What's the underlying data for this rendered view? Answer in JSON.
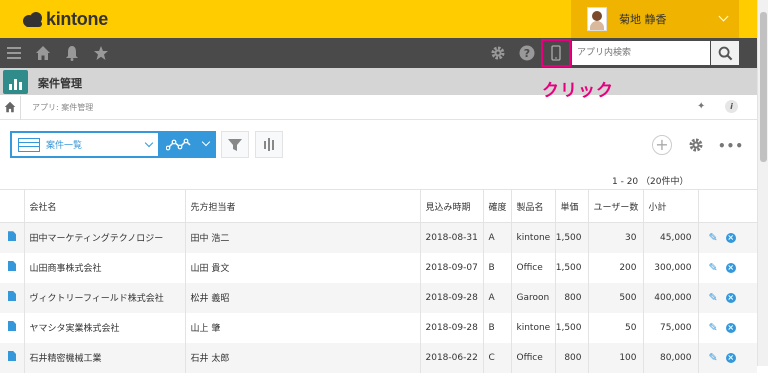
{
  "header": {
    "logo_text": "kintone",
    "user_name": "菊地 静香"
  },
  "navbar": {
    "search_placeholder": "アプリ内検索"
  },
  "app": {
    "title": "案件管理",
    "annotation": "クリック"
  },
  "breadcrumb": {
    "text": "アプリ: 案件管理"
  },
  "toolbar": {
    "view_label": "案件一覧",
    "add_label": "+",
    "more_label": "•••"
  },
  "pager": {
    "text": "1 - 20 （20件中）"
  },
  "table": {
    "headers": [
      "会社名",
      "先方担当者",
      "見込み時期",
      "確度",
      "製品名",
      "単価",
      "ユーザー数",
      "小計"
    ],
    "rows": [
      [
        "田中マーケティングテクノロジー",
        "田中 浩二",
        "2018-08-31",
        "A",
        "kintone",
        "1,500",
        "30",
        "45,000"
      ],
      [
        "山田商事株式会社",
        "山田 貴文",
        "2018-09-07",
        "B",
        "Office",
        "1,500",
        "200",
        "300,000"
      ],
      [
        "ヴィクトリーフィールド株式会社",
        "松井 義昭",
        "2018-09-28",
        "A",
        "Garoon",
        "800",
        "500",
        "400,000"
      ],
      [
        "ヤマシタ実業株式会社",
        "山上 肇",
        "2018-09-28",
        "B",
        "kintone",
        "1,500",
        "50",
        "75,000"
      ],
      [
        "石井精密機械工業",
        "石井 太郎",
        "2018-06-22",
        "C",
        "Office",
        "800",
        "100",
        "80,000"
      ]
    ]
  },
  "colors": {
    "header_yellow": "#ffcc00",
    "nav_dark": "#4a4a4a",
    "accent_blue": "#3498db",
    "highlight_pink": "#e6007e"
  }
}
